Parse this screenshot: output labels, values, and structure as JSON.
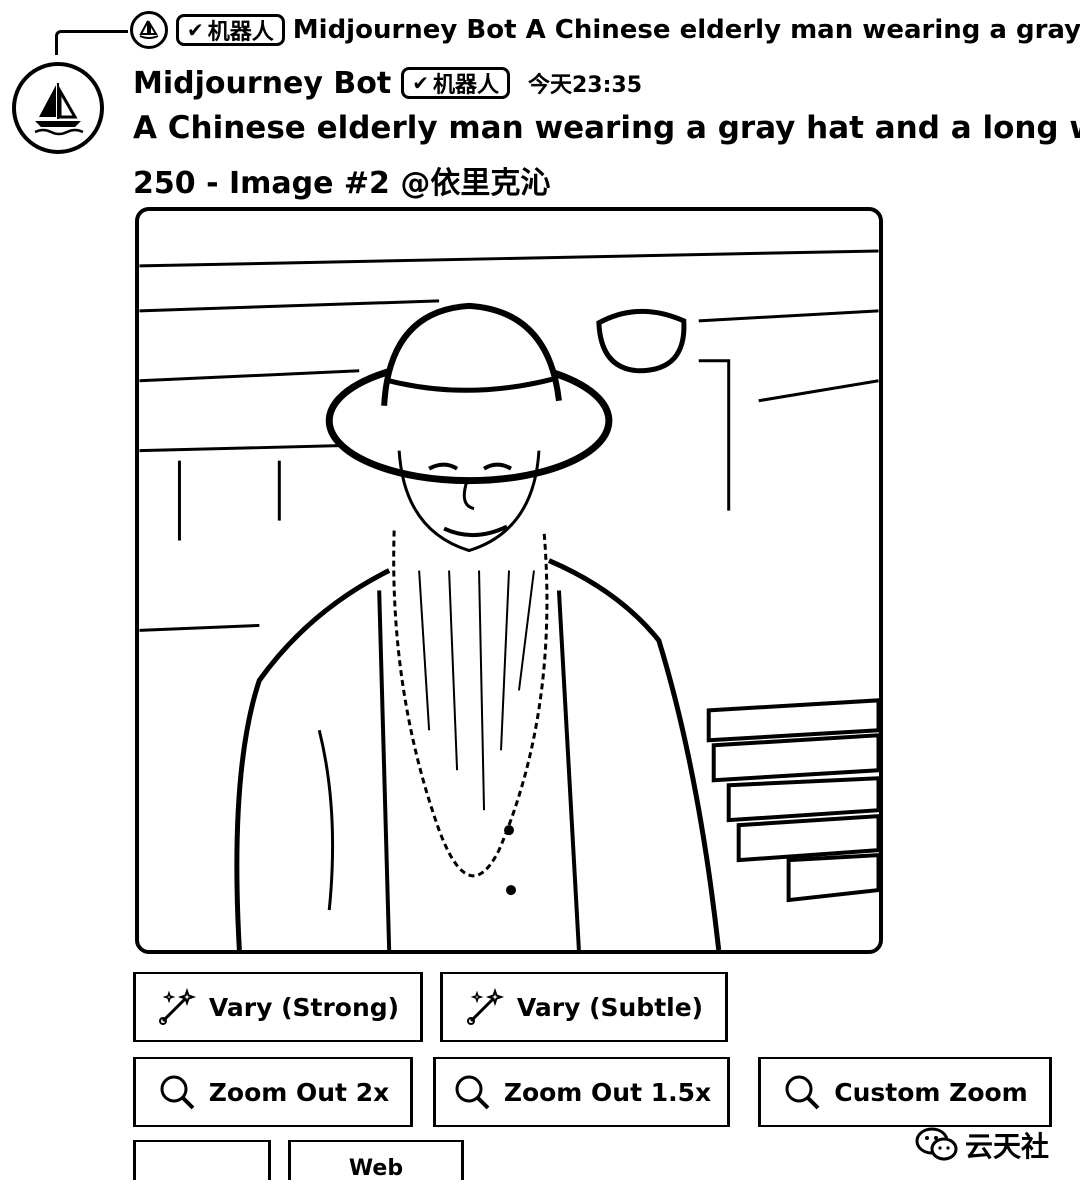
{
  "reply": {
    "badge_label": "机器人",
    "text": "Midjourney Bot A Chinese elderly man wearing a gray hat a"
  },
  "message": {
    "username": "Midjourney Bot",
    "badge_label": "机器人",
    "timestamp": "今天23:35",
    "prompt": "A Chinese elderly man wearing a gray hat and a long white bear",
    "prompt_line2": "250 - Image #2 @依里克沁"
  },
  "buttons": {
    "vary_strong": "Vary (Strong)",
    "vary_subtle": "Vary (Subtle)",
    "zoom_out_2x": "Zoom Out 2x",
    "zoom_out_1_5x": "Zoom Out 1.5x",
    "custom_zoom": "Custom Zoom",
    "partial_web": "Web"
  },
  "icons": {
    "avatar": "sailboat-icon",
    "vary": "magic-wand-icon",
    "zoom": "magnifier-icon",
    "watermark": "wechat-icon"
  },
  "watermark": {
    "text": "云天社"
  }
}
